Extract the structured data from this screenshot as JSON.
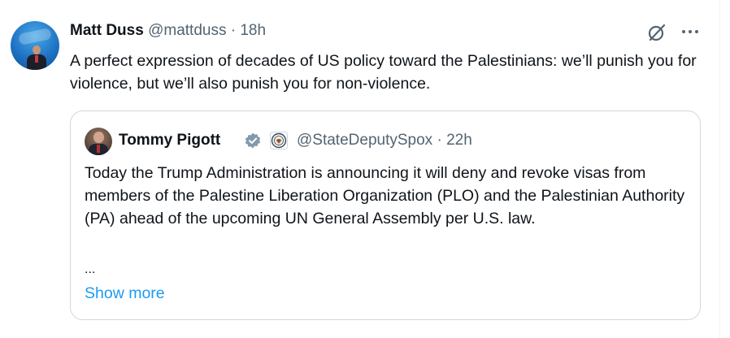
{
  "post": {
    "author_name": "Matt Duss",
    "author_handle": "@mattduss",
    "separator": "·",
    "time": "18h",
    "text": "A perfect expression of decades of US policy toward the Palestinians: we’ll punish you for violence, but we’ll also punish you for non-violence.",
    "icons": {
      "grok": "grok-icon",
      "more": "more-options-icon"
    }
  },
  "quote": {
    "author_name": "Tommy Pigott",
    "affiliation_badge": "us-state-department-seal-icon",
    "verified_badge": "verified-gray-badge-icon",
    "author_handle": "@StateDeputySpox",
    "separator": "·",
    "time": "22h",
    "text": "Today the Trump Administration is announcing it will deny and revoke visas from members of the Palestine Liberation Organization (PLO) and the Palestinian Authority (PA) ahead of the upcoming UN General Assembly per U.S. law.",
    "ellipsis": "...",
    "show_more_label": "Show more"
  },
  "colors": {
    "text_primary": "#0f1419",
    "text_secondary": "#536471",
    "link": "#1d9bf0",
    "border": "#cfd9de"
  }
}
